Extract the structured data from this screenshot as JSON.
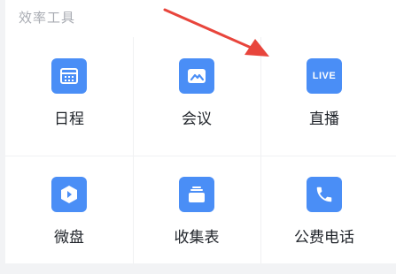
{
  "section": {
    "title": "效率工具"
  },
  "tools": [
    {
      "label": "日程",
      "icon": "calendar-icon"
    },
    {
      "label": "会议",
      "icon": "meeting-icon"
    },
    {
      "label": "直播",
      "icon": "live-icon",
      "badge": "LIVE"
    },
    {
      "label": "微盘",
      "icon": "drive-icon"
    },
    {
      "label": "收集表",
      "icon": "form-icon"
    },
    {
      "label": "公费电话",
      "icon": "phone-icon"
    }
  ],
  "colors": {
    "accent": "#4a8ef6",
    "annotation_arrow": "#e8453c"
  }
}
